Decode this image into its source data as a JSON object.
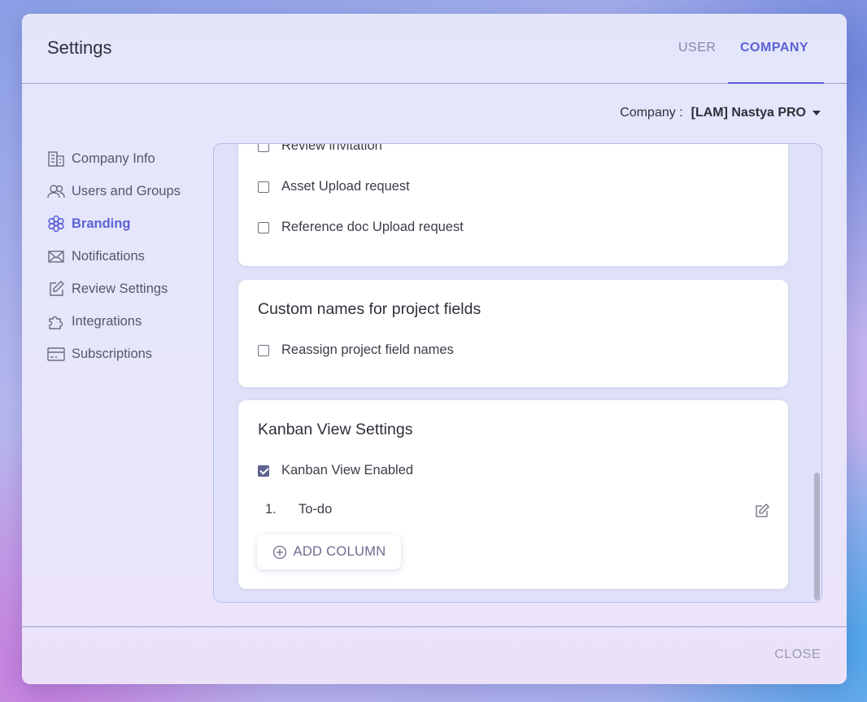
{
  "dialog": {
    "title": "Settings"
  },
  "tabs": {
    "user": "USER",
    "company": "COMPANY"
  },
  "company": {
    "label": "Company :",
    "value": "[LAM] Nastya PRO"
  },
  "nav": {
    "items": [
      {
        "label": "Company Info",
        "icon": "building-icon"
      },
      {
        "label": "Users and Groups",
        "icon": "users-icon"
      },
      {
        "label": "Branding",
        "icon": "flower-icon",
        "active": true
      },
      {
        "label": "Notifications",
        "icon": "envelope-icon"
      },
      {
        "label": "Review Settings",
        "icon": "edit-icon"
      },
      {
        "label": "Integrations",
        "icon": "puzzle-icon"
      },
      {
        "label": "Subscriptions",
        "icon": "card-icon"
      }
    ]
  },
  "requests": {
    "items": [
      {
        "label": "Review invitation",
        "checked": false
      },
      {
        "label": "Asset Upload request",
        "checked": false
      },
      {
        "label": "Reference doc Upload request",
        "checked": false
      }
    ]
  },
  "custom_names": {
    "title": "Custom names for project fields",
    "checkbox": {
      "label": "Reassign project field names",
      "checked": false
    }
  },
  "kanban": {
    "title": "Kanban View Settings",
    "enabled": {
      "label": "Kanban View Enabled",
      "checked": true
    },
    "columns": [
      {
        "number": "1.",
        "name": "To-do"
      }
    ],
    "add_label": "ADD COLUMN"
  },
  "footer": {
    "close_label": "CLOSE"
  },
  "colors": {
    "accent": "#5d61d6",
    "text": "#2f2f3a",
    "checkbox_checked": "#5f6390"
  }
}
